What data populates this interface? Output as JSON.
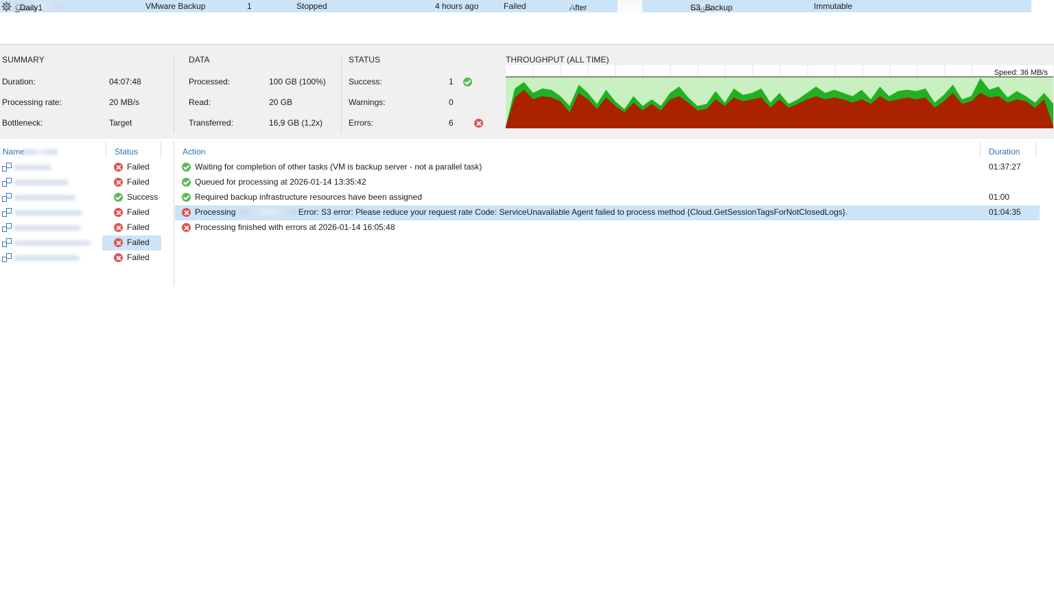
{
  "job_row": {
    "name_prefix": "Cloud",
    "name_suffix": "_Daily1",
    "type": "VMware Backup",
    "objects": "1",
    "status": "Stopped",
    "last_run": "4 hours ago",
    "last_result": "Failed",
    "next_run": "After",
    "target_prefix": "Cloud",
    "target_suffix": "S3_Backup",
    "description": "Immutable"
  },
  "summary": {
    "heading": "SUMMARY",
    "duration_label": "Duration:",
    "duration_value": "04:07:48",
    "rate_label": "Processing rate:",
    "rate_value": "20 MB/s",
    "bottleneck_label": "Bottleneck:",
    "bottleneck_value": "Target"
  },
  "data": {
    "heading": "DATA",
    "processed_label": "Processed:",
    "processed_value": "100 GB (100%)",
    "read_label": "Read:",
    "read_value": "20 GB",
    "transferred_label": "Transferred:",
    "transferred_value": "16,9 GB (1,2x)"
  },
  "status": {
    "heading": "STATUS",
    "success_label": "Success:",
    "success_value": "1",
    "warnings_label": "Warnings:",
    "warnings_value": "0",
    "errors_label": "Errors:",
    "errors_value": "6"
  },
  "throughput": {
    "heading": "THROUGHPUT (ALL TIME)",
    "speed_label": "Speed: 36 MB/s",
    "colors": {
      "read": "#22b022",
      "transfer": "#aa2200",
      "bg": "#c8f0c0"
    }
  },
  "chart_data": {
    "type": "area",
    "series": [
      {
        "values": [
          3,
          62,
          72,
          55,
          62,
          60,
          50,
          35,
          68,
          55,
          38,
          60,
          42,
          30,
          50,
          35,
          45,
          35,
          55,
          65,
          48,
          35,
          38,
          58,
          40,
          62,
          52,
          55,
          62,
          40,
          55,
          38,
          45,
          55,
          65,
          55,
          60,
          55,
          50,
          60,
          45,
          65,
          50,
          58,
          60,
          58,
          62,
          40,
          52,
          68,
          45,
          50,
          78,
          60,
          65,
          48,
          58,
          50,
          40,
          55,
          38
        ]
      },
      {
        "values": [
          3,
          48,
          60,
          45,
          50,
          48,
          42,
          25,
          55,
          45,
          30,
          48,
          35,
          25,
          40,
          28,
          38,
          28,
          45,
          50,
          40,
          28,
          30,
          45,
          35,
          48,
          42,
          45,
          48,
          32,
          45,
          32,
          38,
          45,
          50,
          45,
          48,
          45,
          40,
          45,
          38,
          50,
          42,
          45,
          48,
          45,
          48,
          32,
          42,
          55,
          38,
          42,
          55,
          48,
          50,
          40,
          45,
          42,
          32,
          45,
          3
        ]
      }
    ]
  },
  "vm_table": {
    "col_name": "Name",
    "col_status": "Status",
    "rows": [
      {
        "status": "Failed",
        "kind": "err"
      },
      {
        "status": "Failed",
        "kind": "err"
      },
      {
        "status": "Success",
        "kind": "ok"
      },
      {
        "status": "Failed",
        "kind": "err"
      },
      {
        "status": "Failed",
        "kind": "err"
      },
      {
        "status": "Failed",
        "kind": "err"
      },
      {
        "status": "Failed",
        "kind": "err"
      }
    ]
  },
  "action_table": {
    "col_action": "Action",
    "col_duration": "Duration",
    "rows": [
      {
        "kind": "ok",
        "text": "Waiting for completion of other tasks (VM is backup server - not a parallel task)",
        "duration": "01:37:27"
      },
      {
        "kind": "ok",
        "text": "Queued for processing at 2026-01-14 13:35:42",
        "duration": ""
      },
      {
        "kind": "ok",
        "text": "Required backup infrastructure resources have been assigned",
        "duration": "01:00"
      },
      {
        "kind": "err",
        "text_prefix": "Processing",
        "text": "Error: S3  error: Please reduce your request rate Code: ServiceUnavailable Agent failed to process method {Cloud.GetSessionTagsForNotClosedLogs}.",
        "duration": "01:04:35"
      },
      {
        "kind": "err",
        "text": "Processing finished with errors at 2026-01-14 16:05:48",
        "duration": ""
      }
    ]
  }
}
